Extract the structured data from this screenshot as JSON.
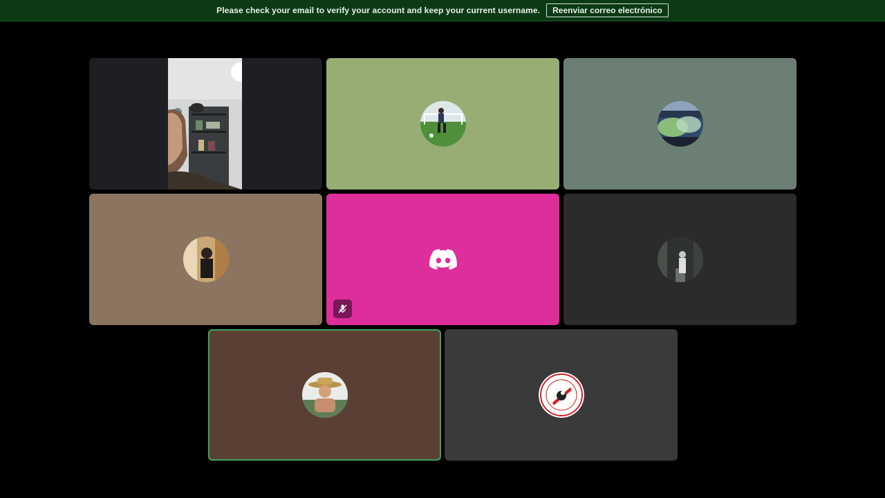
{
  "banner": {
    "message": "Please check your email to verify your account and keep your current username.",
    "button_label": "Reenviar correo electrónico"
  },
  "colors": {
    "banner_bg": "#0b3a14",
    "speaking_outline": "#3ba55d",
    "discord_pink": "#dd2e9b"
  },
  "tiles": [
    {
      "kind": "camera",
      "background": "#1e1f22"
    },
    {
      "kind": "avatar",
      "background": "#97ad74",
      "avatar": "soccer-player-avatar"
    },
    {
      "kind": "avatar",
      "background": "#6b7f75",
      "avatar": "stadium-smoke-avatar"
    },
    {
      "kind": "avatar",
      "background": "#8b7560",
      "avatar": "person-selfie-avatar"
    },
    {
      "kind": "avatar",
      "background": "#dd2e9b",
      "avatar": "discord-logo-icon",
      "muted": true
    },
    {
      "kind": "avatar",
      "background": "#2b2b2b",
      "avatar": "street-night-avatar"
    },
    {
      "kind": "avatar",
      "background": "#5a3f34",
      "avatar": "straw-hat-avatar",
      "speaking": true
    },
    {
      "kind": "avatar",
      "background": "#3a3a3a",
      "avatar": "river-plate-crest-avatar"
    }
  ]
}
